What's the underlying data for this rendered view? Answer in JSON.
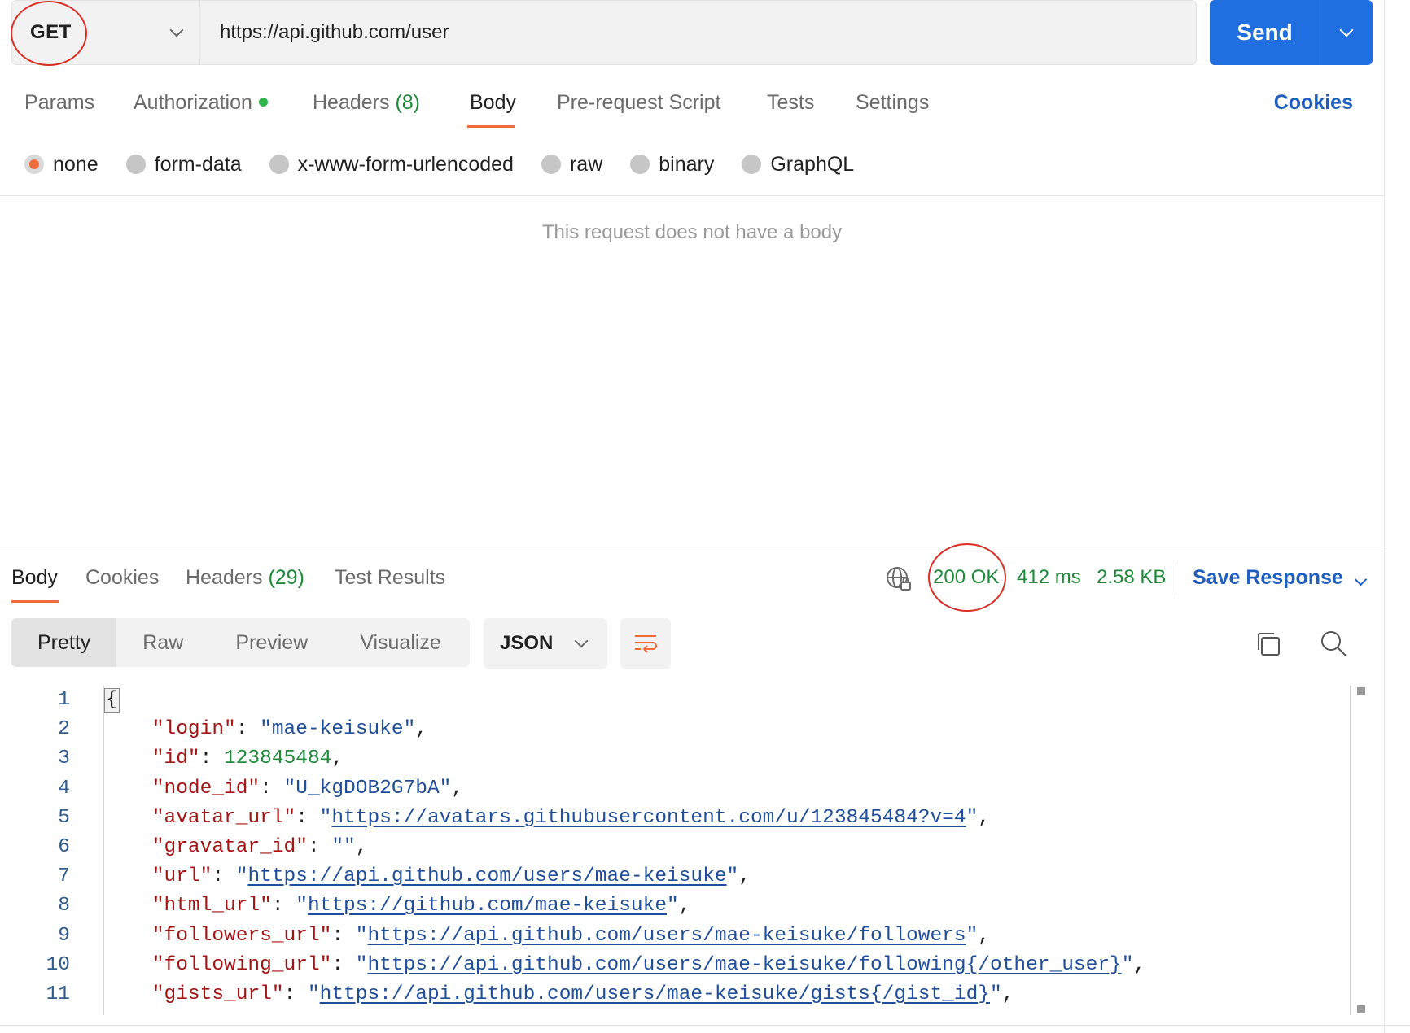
{
  "request": {
    "method": "GET",
    "url": "https://api.github.com/user",
    "send_label": "Send"
  },
  "request_tabs": [
    {
      "label": "Params",
      "count": ""
    },
    {
      "label": "Authorization",
      "count": ""
    },
    {
      "label": "Headers",
      "count": "(8)"
    },
    {
      "label": "Body",
      "count": ""
    },
    {
      "label": "Pre-request Script",
      "count": ""
    },
    {
      "label": "Tests",
      "count": ""
    },
    {
      "label": "Settings",
      "count": ""
    }
  ],
  "cookies_label": "Cookies",
  "body_types": [
    "none",
    "form-data",
    "x-www-form-urlencoded",
    "raw",
    "binary",
    "GraphQL"
  ],
  "body_empty_message": "This request does not have a body",
  "response_tabs": [
    {
      "label": "Body",
      "count": ""
    },
    {
      "label": "Cookies",
      "count": ""
    },
    {
      "label": "Headers",
      "count": "(29)"
    },
    {
      "label": "Test Results",
      "count": ""
    }
  ],
  "response_meta": {
    "status": "200 OK",
    "time": "412 ms",
    "size": "2.58 KB",
    "save_label": "Save Response"
  },
  "view_modes": [
    "Pretty",
    "Raw",
    "Preview",
    "Visualize"
  ],
  "format": "JSON",
  "code_lines": [
    {
      "n": "1",
      "key": "",
      "value": "{",
      "type": "brace"
    },
    {
      "n": "2",
      "key": "\"login\"",
      "value": "\"mae-keisuke\"",
      "type": "string"
    },
    {
      "n": "3",
      "key": "\"id\"",
      "value": "123845484",
      "type": "number"
    },
    {
      "n": "4",
      "key": "\"node_id\"",
      "value": "\"U_kgDOB2G7bA\"",
      "type": "string"
    },
    {
      "n": "5",
      "key": "\"avatar_url\"",
      "value": "https://avatars.githubusercontent.com/u/123845484?v=4",
      "type": "url"
    },
    {
      "n": "6",
      "key": "\"gravatar_id\"",
      "value": "\"\"",
      "type": "string"
    },
    {
      "n": "7",
      "key": "\"url\"",
      "value": "https://api.github.com/users/mae-keisuke",
      "type": "url"
    },
    {
      "n": "8",
      "key": "\"html_url\"",
      "value": "https://github.com/mae-keisuke",
      "type": "url"
    },
    {
      "n": "9",
      "key": "\"followers_url\"",
      "value": "https://api.github.com/users/mae-keisuke/followers",
      "type": "url"
    },
    {
      "n": "10",
      "key": "\"following_url\"",
      "value": "https://api.github.com/users/mae-keisuke/following{/other_user}",
      "type": "url"
    },
    {
      "n": "11",
      "key": "\"gists_url\"",
      "value": "https://api.github.com/users/mae-keisuke/gists{/gist_id}",
      "type": "url"
    }
  ],
  "colors": {
    "accent_orange": "#f26b3a",
    "send_blue": "#1f6fe0",
    "link_blue": "#1f5fbf",
    "success_green": "#1e8a3a",
    "annotation_red": "#d93025"
  }
}
